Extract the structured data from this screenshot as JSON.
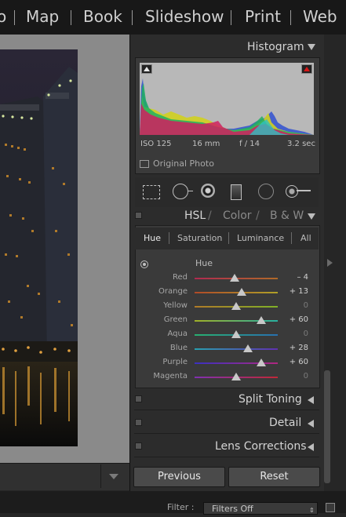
{
  "modules": {
    "cut_label": "o",
    "items": [
      "Map",
      "Book",
      "Slideshow",
      "Print",
      "Web"
    ]
  },
  "histogram": {
    "title": "Histogram",
    "iso": "ISO 125",
    "focal": "16 mm",
    "aperture": "f / 14",
    "shutter": "3.2 sec",
    "original_photo_label": "Original Photo"
  },
  "hsl_header": {
    "hsl": "HSL",
    "slash1": "/",
    "color": "Color",
    "slash2": "/",
    "bw": "B & W"
  },
  "hsl_tabs": [
    "Hue",
    "Saturation",
    "Luminance",
    "All"
  ],
  "hsl_active_tab": "Hue",
  "hsl_section_label": "Hue",
  "hue_sliders": [
    {
      "label": "Red",
      "value": "– 4",
      "amount": -4,
      "track": "red"
    },
    {
      "label": "Orange",
      "value": "+ 13",
      "amount": 13,
      "track": "orange"
    },
    {
      "label": "Yellow",
      "value": "0",
      "amount": 0,
      "track": "yellow"
    },
    {
      "label": "Green",
      "value": "+ 60",
      "amount": 60,
      "track": "green"
    },
    {
      "label": "Aqua",
      "value": "0",
      "amount": 0,
      "track": "aqua"
    },
    {
      "label": "Blue",
      "value": "+ 28",
      "amount": 28,
      "track": "blue"
    },
    {
      "label": "Purple",
      "value": "+ 60",
      "amount": 60,
      "track": "purple"
    },
    {
      "label": "Magenta",
      "value": "0",
      "amount": 0,
      "track": "magenta"
    }
  ],
  "panels": {
    "split_toning": "Split Toning",
    "detail": "Detail",
    "lens_corrections": "Lens Corrections"
  },
  "buttons": {
    "previous": "Previous",
    "reset": "Reset"
  },
  "filter": {
    "label": "Filter :",
    "value": "Filters Off"
  },
  "colors": {
    "panel_bg": "#2c2c2c",
    "text": "#c8c8c8",
    "histogram_bg": "#b8b8b8"
  }
}
